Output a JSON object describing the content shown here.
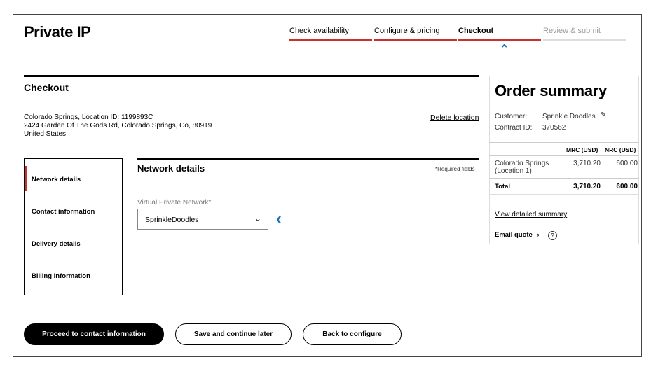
{
  "header": {
    "title": "Private IP",
    "steps": [
      {
        "label": "Check availability",
        "state": "done"
      },
      {
        "label": "Configure & pricing",
        "state": "done"
      },
      {
        "label": "Checkout",
        "state": "active"
      },
      {
        "label": "Review & submit",
        "state": "inactive"
      }
    ]
  },
  "checkout": {
    "heading": "Checkout",
    "address": [
      "Colorado Springs, Location ID: 1199893C",
      "2424 Garden Of The Gods Rd, Colorado Springs, Co, 80919",
      "United States"
    ],
    "delete_location": "Delete location"
  },
  "sidenav": {
    "items": [
      "Network details",
      "Contact information",
      "Delivery details",
      "Billing information"
    ]
  },
  "network": {
    "heading": "Network details",
    "required_note": "*Required fields",
    "vpn_label": "Virtual Private Network*",
    "vpn_value": "SprinkleDoodles"
  },
  "buttons": {
    "proceed": "Proceed to contact information",
    "save": "Save and continue later",
    "back": "Back to configure"
  },
  "summary": {
    "title": "Order summary",
    "customer_label": "Customer:",
    "customer": "Sprinkle Doodles",
    "contract_label": "Contract ID:",
    "contract": "370562",
    "col_mrc": "MRC (USD)",
    "col_nrc": "NRC (USD)",
    "rows": [
      {
        "name": "Colorado Springs (Location 1)",
        "mrc": "3,710.20",
        "nrc": "600.00"
      }
    ],
    "total_label": "Total",
    "total_mrc": "3,710.20",
    "total_nrc": "600.00",
    "view_detailed": "View detailed summary",
    "email_quote": "Email quote"
  },
  "colors": {
    "accent": "#c8312d",
    "link_blue": "#1a73b5"
  }
}
